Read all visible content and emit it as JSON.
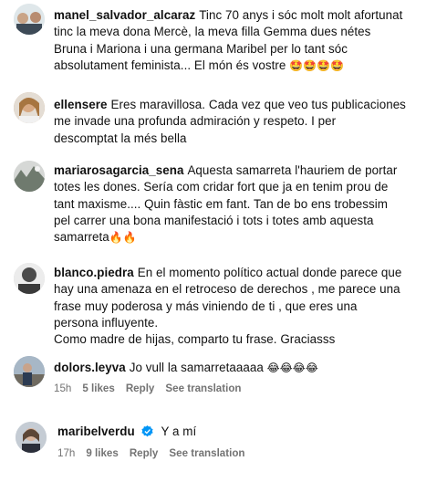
{
  "comments": [
    {
      "user": "manel_salvador_alcaraz",
      "lines": [
        "Tinc 70 anys i sóc molt molt afortunat",
        "tinc la meva dona Mercè, la meva filla Gemma dues nétes",
        "Bruna i Mariona i una germana Maribel per lo tant sóc",
        "absolutament feminista... El món és vostre"
      ],
      "emoji": "🤩🤩🤩🤩"
    },
    {
      "user": "ellensere",
      "lines": [
        "Eres maravillosa. Cada vez que veo tus publicaciones",
        "me invade una profunda admiración y respeto. I per",
        "descomptat la més bella"
      ]
    },
    {
      "user": "mariarosagarcia_sena",
      "lines": [
        "Aquesta samarreta l'hauriem de portar",
        "totes les dones. Sería com cridar fort que ja en tenim prou de",
        "tant maxisme.... Quin fàstic em fant. Tan de bo ens trobessim",
        "pel carrer una bona manifestació i tots i totes amb aquesta",
        "samarreta"
      ],
      "emoji": "🔥🔥"
    },
    {
      "user": "blanco.piedra",
      "lines": [
        "En el momento político actual donde parece que",
        "hay una amenaza en el retroceso de derechos , me parece una",
        "frase muy poderosa y más viniendo de ti , que eres una",
        "persona influyente.",
        "Como madre de hijas, comparto tu frase. Graciasss"
      ]
    },
    {
      "user": "dolors.leyva",
      "lines": [
        "Jo vull la samarretaaaaa"
      ],
      "emoji": "😂😂😂😂",
      "meta": {
        "time": "15h",
        "likes": "5 likes",
        "reply": "Reply",
        "translate": "See translation"
      }
    },
    {
      "user": "maribelverdu",
      "lines": [
        "Y a mí"
      ],
      "meta": {
        "time": "17h",
        "likes": "9 likes",
        "reply": "Reply",
        "translate": "See translation"
      }
    }
  ]
}
